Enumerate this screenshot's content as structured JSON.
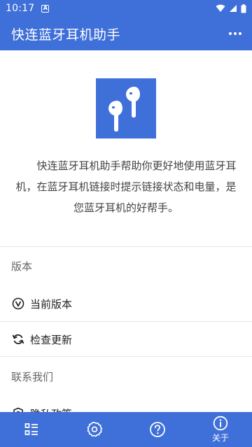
{
  "status_bar": {
    "time": "10:17",
    "notification_glyph": "A",
    "icons": [
      "wifi-icon",
      "signal-icon",
      "battery-icon"
    ]
  },
  "app_bar": {
    "title": "快连蓝牙耳机助手",
    "more_icon": "more-vert-icon"
  },
  "intro": {
    "logo_icon": "earbuds-icon",
    "text": "快连蓝牙耳机助手帮助你更好地使用蓝牙耳机，在蓝牙耳机链接时提示链接状态和电量，是您蓝牙耳机的好帮手。"
  },
  "version_section": {
    "header": "版本",
    "items": [
      {
        "label": "当前版本",
        "icon": "version-icon"
      },
      {
        "label": "检查更新",
        "icon": "refresh-icon"
      }
    ]
  },
  "contact_section": {
    "header": "联系我们",
    "items": [
      {
        "label": "隐私政策",
        "icon": "shield-icon"
      }
    ]
  },
  "bottom_nav": {
    "tabs": [
      {
        "label": "",
        "icon": "list-icon"
      },
      {
        "label": "",
        "icon": "settings-icon"
      },
      {
        "label": "",
        "icon": "help-icon"
      },
      {
        "label": "关于",
        "icon": "info-icon",
        "active": true
      }
    ]
  },
  "colors": {
    "primary": "#3f6fd8",
    "background": "#ffffff",
    "divider": "#e6e6e6"
  }
}
